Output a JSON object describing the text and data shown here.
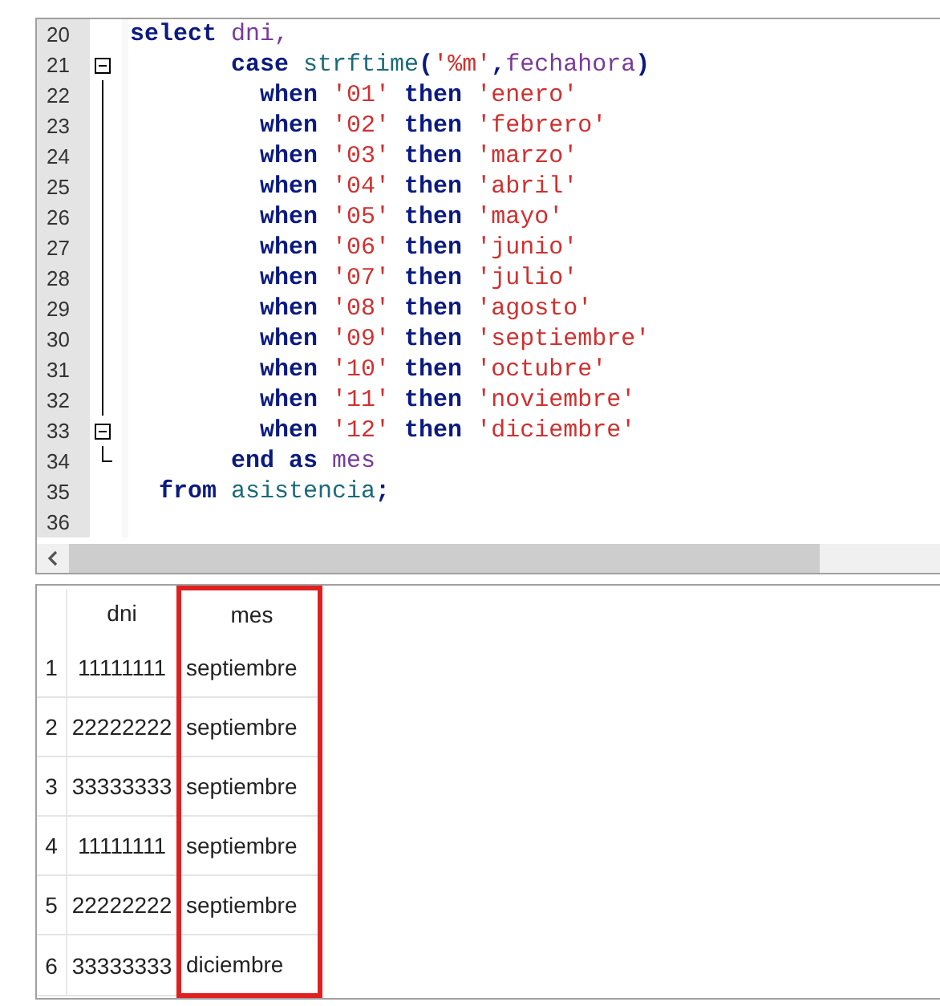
{
  "editor": {
    "lines": [
      {
        "number": "20",
        "tokens": [
          {
            "kind": "keyword",
            "text": "select "
          },
          {
            "kind": "identifier",
            "text": "dni,"
          }
        ]
      },
      {
        "number": "21",
        "fold_box": true,
        "fold_line": true,
        "fold_end": false,
        "tokens": [
          {
            "kind": "keyword",
            "text": "       case "
          },
          {
            "kind": "function",
            "text": "strftime"
          },
          {
            "kind": "keyword",
            "text": "("
          },
          {
            "kind": "string",
            "text": "'%m'"
          },
          {
            "kind": "keyword",
            "text": ","
          },
          {
            "kind": "identifier",
            "text": "fechahora"
          },
          {
            "kind": "keyword",
            "text": ")"
          }
        ]
      },
      {
        "number": "22",
        "fold_box": false,
        "fold_line": true,
        "fold_end": false,
        "tokens": [
          {
            "kind": "keyword",
            "text": "         when "
          },
          {
            "kind": "string",
            "text": "'01'"
          },
          {
            "kind": "keyword",
            "text": " then "
          },
          {
            "kind": "string",
            "text": "'enero'"
          }
        ]
      },
      {
        "number": "23",
        "fold_box": false,
        "fold_line": true,
        "fold_end": false,
        "tokens": [
          {
            "kind": "keyword",
            "text": "         when "
          },
          {
            "kind": "string",
            "text": "'02'"
          },
          {
            "kind": "keyword",
            "text": " then "
          },
          {
            "kind": "string",
            "text": "'febrero'"
          }
        ]
      },
      {
        "number": "24",
        "fold_box": false,
        "fold_line": true,
        "fold_end": false,
        "tokens": [
          {
            "kind": "keyword",
            "text": "         when "
          },
          {
            "kind": "string",
            "text": "'03'"
          },
          {
            "kind": "keyword",
            "text": " then "
          },
          {
            "kind": "string",
            "text": "'marzo'"
          }
        ]
      },
      {
        "number": "25",
        "fold_box": false,
        "fold_line": true,
        "fold_end": false,
        "tokens": [
          {
            "kind": "keyword",
            "text": "         when "
          },
          {
            "kind": "string",
            "text": "'04'"
          },
          {
            "kind": "keyword",
            "text": " then "
          },
          {
            "kind": "string",
            "text": "'abril'"
          }
        ]
      },
      {
        "number": "26",
        "fold_box": false,
        "fold_line": true,
        "fold_end": false,
        "tokens": [
          {
            "kind": "keyword",
            "text": "         when "
          },
          {
            "kind": "string",
            "text": "'05'"
          },
          {
            "kind": "keyword",
            "text": " then "
          },
          {
            "kind": "string",
            "text": "'mayo'"
          }
        ]
      },
      {
        "number": "27",
        "fold_box": false,
        "fold_line": true,
        "fold_end": false,
        "tokens": [
          {
            "kind": "keyword",
            "text": "         when "
          },
          {
            "kind": "string",
            "text": "'06'"
          },
          {
            "kind": "keyword",
            "text": " then "
          },
          {
            "kind": "string",
            "text": "'junio'"
          }
        ]
      },
      {
        "number": "28",
        "fold_box": false,
        "fold_line": true,
        "fold_end": false,
        "tokens": [
          {
            "kind": "keyword",
            "text": "         when "
          },
          {
            "kind": "string",
            "text": "'07'"
          },
          {
            "kind": "keyword",
            "text": " then "
          },
          {
            "kind": "string",
            "text": "'julio'"
          }
        ]
      },
      {
        "number": "29",
        "fold_box": false,
        "fold_line": true,
        "fold_end": false,
        "tokens": [
          {
            "kind": "keyword",
            "text": "         when "
          },
          {
            "kind": "string",
            "text": "'08'"
          },
          {
            "kind": "keyword",
            "text": " then "
          },
          {
            "kind": "string",
            "text": "'agosto'"
          }
        ]
      },
      {
        "number": "30",
        "fold_box": false,
        "fold_line": true,
        "fold_end": false,
        "tokens": [
          {
            "kind": "keyword",
            "text": "         when "
          },
          {
            "kind": "string",
            "text": "'09'"
          },
          {
            "kind": "keyword",
            "text": " then "
          },
          {
            "kind": "string",
            "text": "'septiembre'"
          }
        ]
      },
      {
        "number": "31",
        "fold_box": false,
        "fold_line": true,
        "fold_end": false,
        "tokens": [
          {
            "kind": "keyword",
            "text": "         when "
          },
          {
            "kind": "string",
            "text": "'10'"
          },
          {
            "kind": "keyword",
            "text": " then "
          },
          {
            "kind": "string",
            "text": "'octubre'"
          }
        ]
      },
      {
        "number": "32",
        "fold_box": false,
        "fold_line": true,
        "fold_end": false,
        "tokens": [
          {
            "kind": "keyword",
            "text": "         when "
          },
          {
            "kind": "string",
            "text": "'11'"
          },
          {
            "kind": "keyword",
            "text": " then "
          },
          {
            "kind": "string",
            "text": "'noviembre'"
          }
        ]
      },
      {
        "number": "33",
        "fold_box": true,
        "fold_line": true,
        "fold_end": false,
        "tokens": [
          {
            "kind": "keyword",
            "text": "         when "
          },
          {
            "kind": "string",
            "text": "'12'"
          },
          {
            "kind": "keyword",
            "text": " then "
          },
          {
            "kind": "string",
            "text": "'diciembre'"
          }
        ]
      },
      {
        "number": "34",
        "fold_box": false,
        "fold_line": false,
        "fold_end": true,
        "tokens": [
          {
            "kind": "keyword",
            "text": "       end as "
          },
          {
            "kind": "identifier",
            "text": "mes"
          }
        ]
      },
      {
        "number": "35",
        "tokens": [
          {
            "kind": "keyword",
            "text": "  from "
          },
          {
            "kind": "function",
            "text": "asistencia"
          },
          {
            "kind": "keyword",
            "text": ";"
          }
        ]
      },
      {
        "number": "36"
      }
    ]
  },
  "results": {
    "columns": [
      {
        "label": "dni",
        "highlighted": false
      },
      {
        "label": "mes",
        "highlighted": true
      }
    ],
    "rows": [
      {
        "number": "1",
        "cells": [
          "11111111",
          "septiembre"
        ]
      },
      {
        "number": "2",
        "cells": [
          "22222222",
          "septiembre"
        ]
      },
      {
        "number": "3",
        "cells": [
          "33333333",
          "septiembre"
        ]
      },
      {
        "number": "4",
        "cells": [
          "11111111",
          "septiembre"
        ]
      },
      {
        "number": "5",
        "cells": [
          "22222222",
          "septiembre"
        ]
      },
      {
        "number": "6",
        "cells": [
          "33333333",
          "diciembre"
        ]
      }
    ]
  }
}
